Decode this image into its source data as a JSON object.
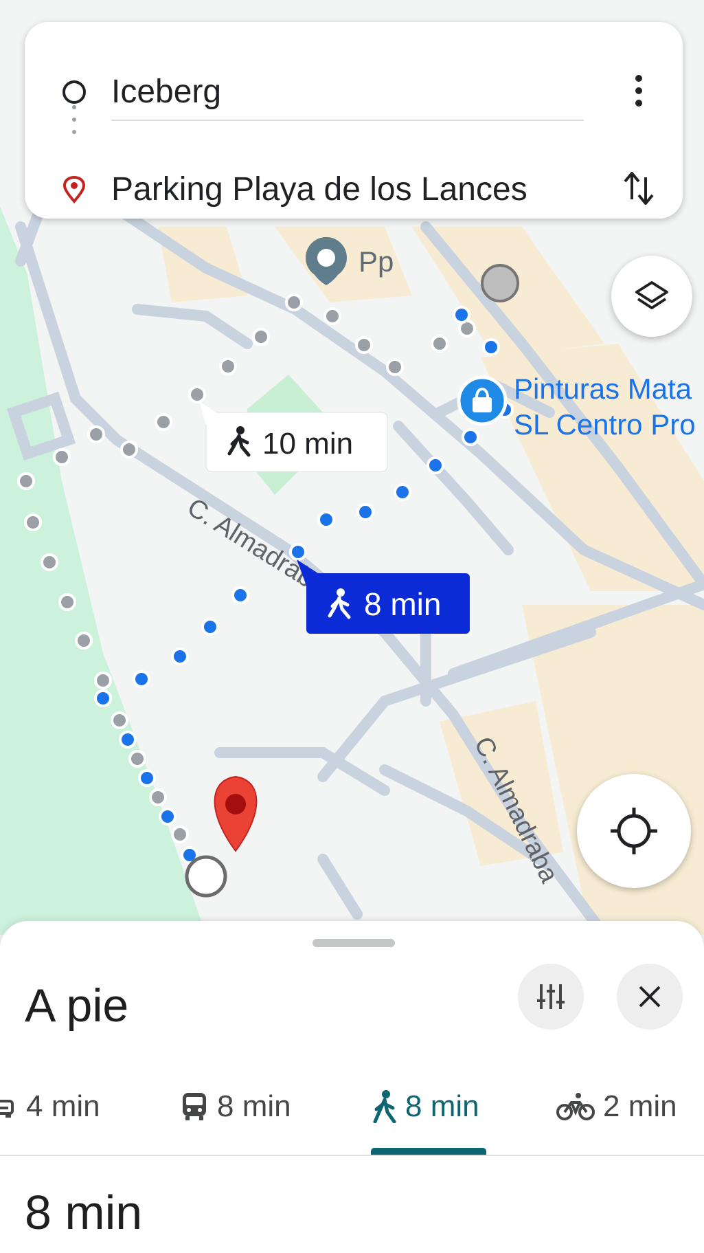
{
  "search": {
    "origin": "Iceberg",
    "destination": "Parking Playa de los Lances"
  },
  "map": {
    "place_pp": "Pp",
    "poi_name_line1": "Pinturas Mata",
    "poi_name_line2": "SL Centro Pro",
    "street_1": "C. Almadraba",
    "street_2": "C. Almadraba",
    "route_alt_time": "10 min",
    "route_main_time": "8 min"
  },
  "sheet": {
    "title": "A pie",
    "modes": [
      {
        "icon": "car-icon",
        "label": "4 min"
      },
      {
        "icon": "transit-icon",
        "label": "8 min"
      },
      {
        "icon": "walk-icon",
        "label": "8 min",
        "selected": true
      },
      {
        "icon": "bike-icon",
        "label": "2 min"
      }
    ],
    "summary_time": "8 min"
  },
  "colors": {
    "route_blue": "#1a73e8",
    "route_alt_grey": "#9aa0a6",
    "selected_mode": "#0b6672",
    "destination_pin": "#ea4335",
    "label_blue": "#0b2bd6"
  }
}
